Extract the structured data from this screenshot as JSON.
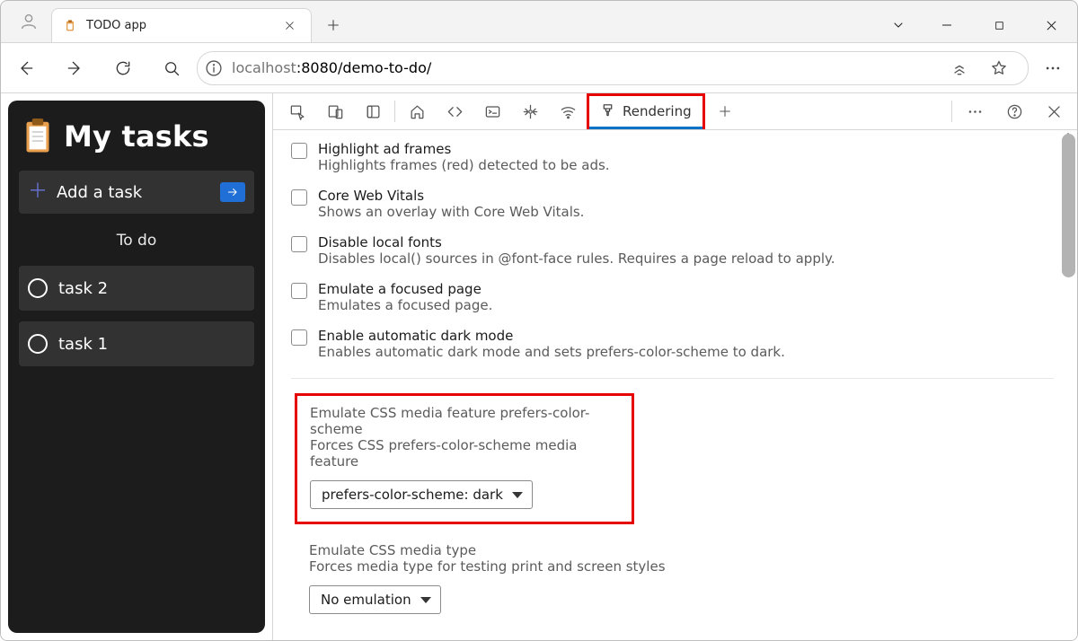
{
  "tab": {
    "title": "TODO app"
  },
  "address": {
    "host_prefix": "localhost",
    "rest": ":8080/demo-to-do/"
  },
  "app": {
    "title": "My tasks",
    "add_task_label": "Add a task",
    "section_todo": "To do",
    "tasks": [
      "task 2",
      "task 1"
    ]
  },
  "devtools": {
    "rendering_tab_label": "Rendering",
    "options": [
      {
        "title": "Highlight ad frames",
        "desc": "Highlights frames (red) detected to be ads."
      },
      {
        "title": "Core Web Vitals",
        "desc": "Shows an overlay with Core Web Vitals."
      },
      {
        "title": "Disable local fonts",
        "desc": "Disables local() sources in @font-face rules. Requires a page reload to apply."
      },
      {
        "title": "Emulate a focused page",
        "desc": "Emulates a focused page."
      },
      {
        "title": "Enable automatic dark mode",
        "desc": "Enables automatic dark mode and sets prefers-color-scheme to dark."
      }
    ],
    "emulate_scheme": {
      "title": "Emulate CSS media feature prefers-color-scheme",
      "desc": "Forces CSS prefers-color-scheme media feature",
      "selected": "prefers-color-scheme: dark"
    },
    "emulate_media": {
      "title": "Emulate CSS media type",
      "desc": "Forces media type for testing print and screen styles",
      "selected": "No emulation"
    }
  }
}
